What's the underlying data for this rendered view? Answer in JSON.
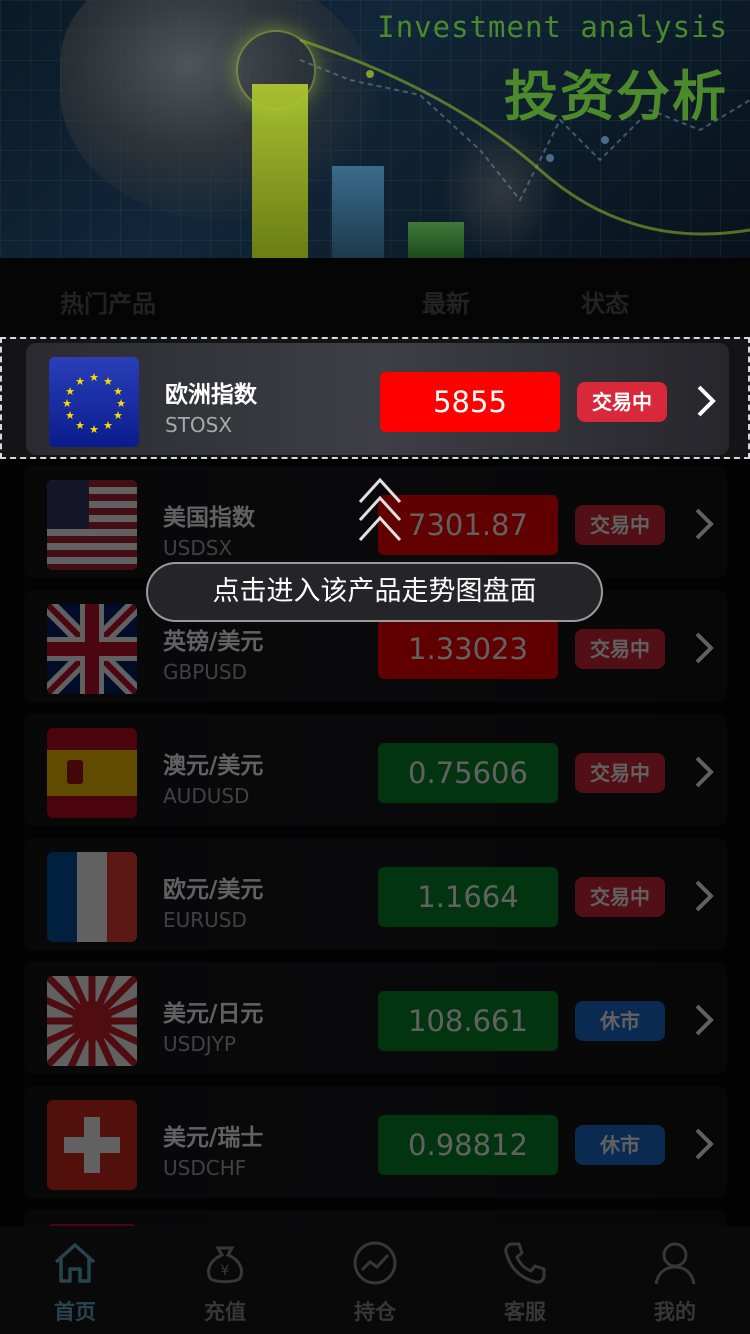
{
  "banner": {
    "title_en": "Investment analysis",
    "title_cn": "投资分析"
  },
  "list_header": {
    "name": "热门产品",
    "latest": "最新",
    "status": "状态"
  },
  "products": [
    {
      "name": "欧洲指数",
      "code": "STOSX",
      "price": "5855",
      "trend": "up",
      "status": "交易中",
      "flag": "eu-flag"
    },
    {
      "name": "美国指数",
      "code": "USDSX",
      "price": "7301.87",
      "trend": "up",
      "status": "交易中",
      "flag": "us-flag"
    },
    {
      "name": "英镑/美元",
      "code": "GBPUSD",
      "price": "1.33023",
      "trend": "up",
      "status": "交易中",
      "flag": "uk-flag"
    },
    {
      "name": "澳元/美元",
      "code": "AUDUSD",
      "price": "0.75606",
      "trend": "down",
      "status": "交易中",
      "flag": "spain-flag"
    },
    {
      "name": "欧元/美元",
      "code": "EURUSD",
      "price": "1.1664",
      "trend": "down",
      "status": "交易中",
      "flag": "france-flag"
    },
    {
      "name": "美元/日元",
      "code": "USDJYP",
      "price": "108.661",
      "trend": "down",
      "status": "休市",
      "flag": "japan-flag"
    },
    {
      "name": "美元/瑞士",
      "code": "USDCHF",
      "price": "0.98812",
      "trend": "down",
      "status": "休市",
      "flag": "swiss-flag"
    }
  ],
  "guide": {
    "tooltip": "点击进入该产品走势图盘面"
  },
  "tabs": [
    {
      "label": "首页",
      "icon": "home-icon",
      "active": true
    },
    {
      "label": "充值",
      "icon": "money-bag-icon",
      "active": false
    },
    {
      "label": "持仓",
      "icon": "chart-circle-icon",
      "active": false
    },
    {
      "label": "客服",
      "icon": "phone-icon",
      "active": false
    },
    {
      "label": "我的",
      "icon": "user-icon",
      "active": false
    }
  ],
  "colors": {
    "price_up": "#ff0000",
    "price_down": "#0a8a2a",
    "status_trading": "#d9283a",
    "status_closed": "#1d6fd6",
    "accent_green": "#4c8a2c"
  }
}
